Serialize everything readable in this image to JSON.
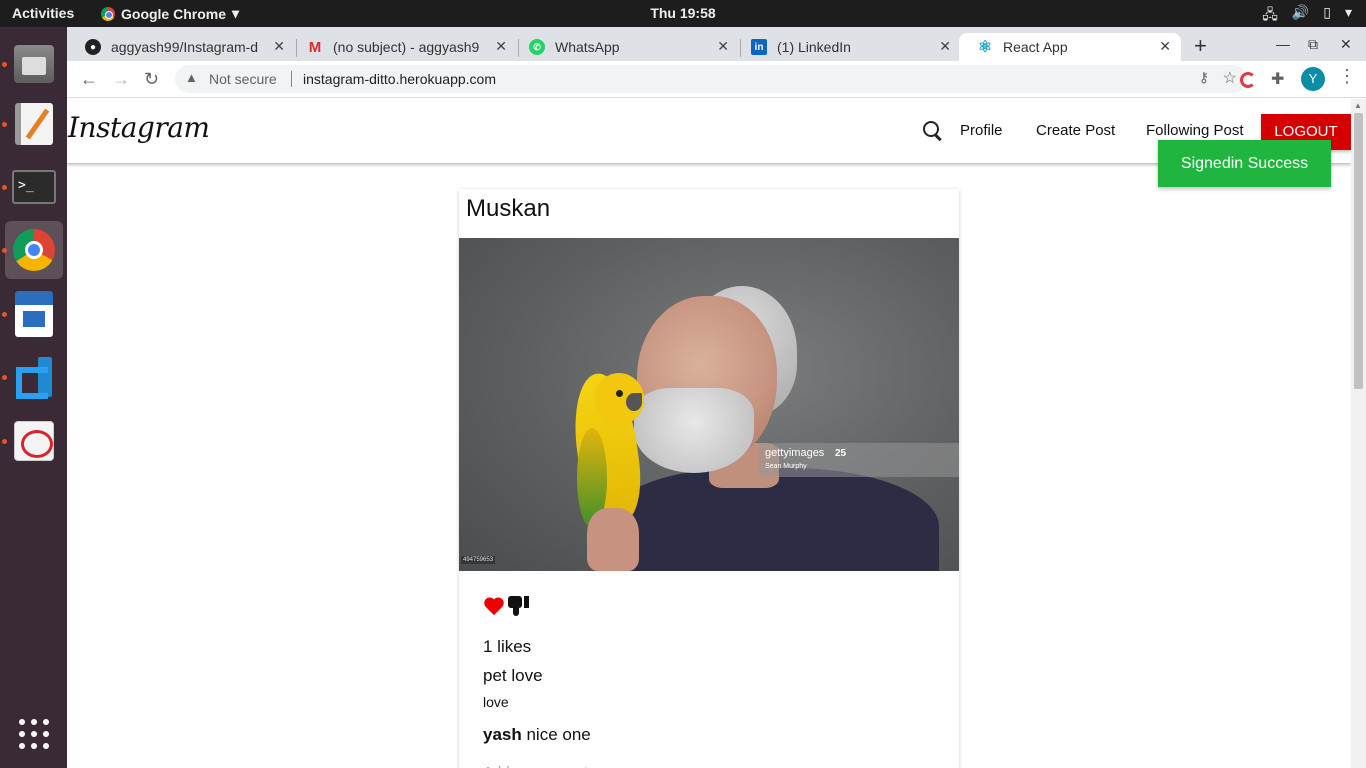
{
  "system_bar": {
    "activities": "Activities",
    "app_name": "Google Chrome",
    "clock": "Thu 19:58"
  },
  "dock": {
    "items": [
      "files",
      "text-editor",
      "terminal",
      "chrome",
      "libreoffice-writer",
      "vscode",
      "pdf-viewer",
      "show-applications"
    ]
  },
  "browser": {
    "tabs": [
      {
        "title": "aggyash99/Instagram-d",
        "favicon": "github-icon"
      },
      {
        "title": "(no subject) - aggyash9",
        "favicon": "gmail-icon"
      },
      {
        "title": "WhatsApp",
        "favicon": "whatsapp-icon"
      },
      {
        "title": "(1) LinkedIn",
        "favicon": "linkedin-icon"
      },
      {
        "title": "React App",
        "favicon": "react-icon",
        "active": true
      }
    ],
    "security_label": "Not secure",
    "url": "instagram-ditto.herokuapp.com",
    "profile_initial": "Y"
  },
  "app": {
    "logo": "Instagram",
    "nav": {
      "profile": "Profile",
      "create_post": "Create Post",
      "following_post": "Following Post",
      "logout": "LOGOUT"
    },
    "toast": "Signedin Success",
    "post": {
      "author": "Muskan",
      "likes": "1 likes",
      "title": "pet love",
      "body": "love",
      "comments": [
        {
          "user": "yash",
          "text": " nice one"
        }
      ],
      "comment_placeholder": "Add a comment",
      "image_watermark": {
        "brand": "gettyimages",
        "id": "25",
        "credit": "Sean Murphy",
        "photo_id": "494759653"
      }
    }
  },
  "colors": {
    "logout_bg": "#d50000",
    "toast_bg": "#1fb53f",
    "dock_bg": "#3a2a35",
    "like_heart": "#ee0000"
  }
}
